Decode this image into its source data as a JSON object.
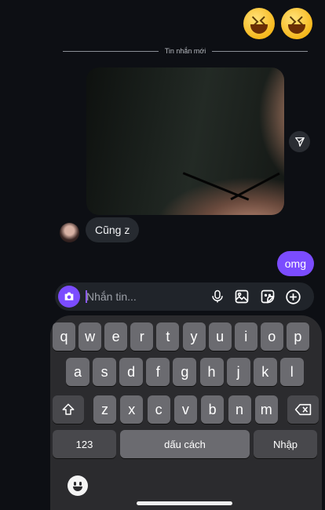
{
  "thread": {
    "reactions": [
      "laughing-emoji",
      "laughing-emoji"
    ],
    "divider_label": "Tin nhắn mới",
    "received_message": "Cũng z",
    "sent_message": "omg"
  },
  "composer": {
    "placeholder": "Nhắn tin...",
    "icons": [
      "camera-icon",
      "microphone-icon",
      "gallery-icon",
      "sticker-icon",
      "plus-icon"
    ]
  },
  "keyboard": {
    "row1": [
      "q",
      "w",
      "e",
      "r",
      "t",
      "y",
      "u",
      "i",
      "o",
      "p"
    ],
    "row2": [
      "a",
      "s",
      "d",
      "f",
      "g",
      "h",
      "j",
      "k",
      "l"
    ],
    "row3": [
      "z",
      "x",
      "c",
      "v",
      "b",
      "n",
      "m"
    ],
    "numbers_label": "123",
    "space_label": "dấu cách",
    "return_label": "Nhập"
  },
  "colors": {
    "accent": "#7b4cff",
    "background": "#0d0f14",
    "received_bubble": "#262a30"
  }
}
